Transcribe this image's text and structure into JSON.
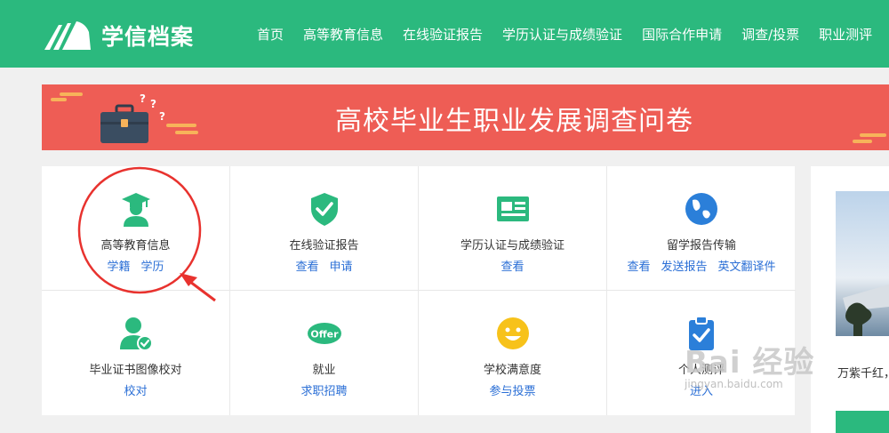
{
  "header": {
    "logo_text": "学信档案",
    "nav": [
      "首页",
      "高等教育信息",
      "在线验证报告",
      "学历认证与成绩验证",
      "国际合作申请",
      "调查/投票",
      "职业测评"
    ]
  },
  "banner": {
    "title": "高校毕业生职业发展调查问卷"
  },
  "cards": [
    {
      "title": "高等教育信息",
      "links": [
        "学籍",
        "学历"
      ],
      "icon": "graduate-icon"
    },
    {
      "title": "在线验证报告",
      "links": [
        "查看",
        "申请"
      ],
      "icon": "shield-check-icon"
    },
    {
      "title": "学历认证与成绩验证",
      "links": [
        "查看"
      ],
      "icon": "id-card-icon"
    },
    {
      "title": "留学报告传输",
      "links": [
        "查看",
        "发送报告",
        "英文翻译件"
      ],
      "icon": "globe-icon"
    },
    {
      "title": "毕业证书图像校对",
      "links": [
        "校对"
      ],
      "icon": "user-check-icon"
    },
    {
      "title": "就业",
      "links": [
        "求职招聘"
      ],
      "icon": "offer-icon",
      "badge": "Offer"
    },
    {
      "title": "学校满意度",
      "links": [
        "参与投票"
      ],
      "icon": "smiley-icon"
    },
    {
      "title": "个人测评",
      "links": [
        "进入"
      ],
      "icon": "clipboard-check-icon"
    }
  ],
  "side": {
    "caption": "万紫千红，"
  },
  "watermark": {
    "brand": "Bai 经验",
    "url": "jingyan.baidu.com"
  },
  "colors": {
    "brand_green": "#2bb97e",
    "banner_red": "#ee5d55",
    "link_blue": "#2b6fd6",
    "annotation_red": "#e8322e"
  }
}
